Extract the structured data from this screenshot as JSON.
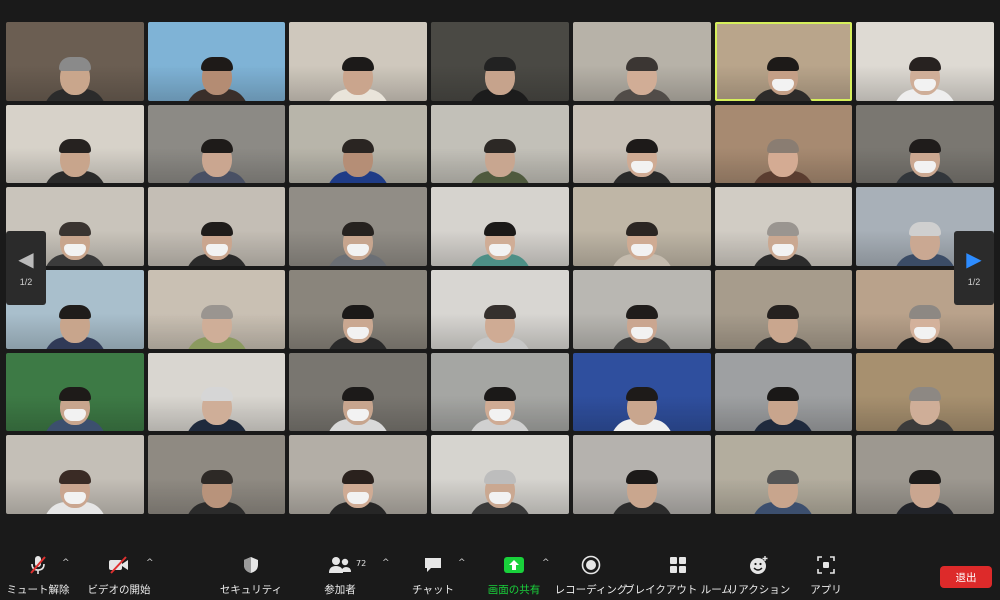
{
  "gallery": {
    "page_indicator_left": "1/2",
    "page_indicator_right": "1/2",
    "tiles": [
      {
        "bg": "#6b5e52",
        "skin": "#c9a68c",
        "hair": "#8a8a8a",
        "shirt": "#2b2b2b",
        "mask": false
      },
      {
        "bg": "#7fb3d6",
        "skin": "#b48c73",
        "hair": "#1e1a18",
        "shirt": "#3a2f2a",
        "mask": false
      },
      {
        "bg": "#cfc8bd",
        "skin": "#caa58d",
        "hair": "#1c1a19",
        "shirt": "#e9e4da",
        "mask": false
      },
      {
        "bg": "#4a4944",
        "skin": "#c6a38c",
        "hair": "#222",
        "shirt": "#1c1c1c",
        "mask": false
      },
      {
        "bg": "#b7b2a8",
        "skin": "#d1ad96",
        "hair": "#3b3633",
        "shirt": "#514c48",
        "mask": false
      },
      {
        "bg": "#b9a58b",
        "skin": "#c49f86",
        "hair": "#1d1a18",
        "shirt": "#2d2b2a",
        "mask": true
      },
      {
        "bg": "#dedad3",
        "skin": "#cfae98",
        "hair": "#272220",
        "shirt": "#eeeeee",
        "mask": true
      },
      {
        "bg": "#d7d2c9",
        "skin": "#c8a58c",
        "hair": "#262220",
        "shirt": "#2a2a2a",
        "mask": false
      },
      {
        "bg": "#8c8a85",
        "skin": "#caa690",
        "hair": "#1e1b19",
        "shirt": "#495064",
        "mask": false
      },
      {
        "bg": "#b8b5aa",
        "skin": "#b58e76",
        "hair": "#2a2522",
        "shirt": "#1f3c87",
        "mask": false
      },
      {
        "bg": "#c2c0b8",
        "skin": "#c8a690",
        "hair": "#2c2825",
        "shirt": "#4f5a3e",
        "mask": false
      },
      {
        "bg": "#c8c1b7",
        "skin": "#cfab94",
        "hair": "#1d1a19",
        "shirt": "#2a2a2a",
        "mask": true
      },
      {
        "bg": "#a78a71",
        "skin": "#d4ab93",
        "hair": "#8a7d72",
        "shirt": "#5a3d30",
        "mask": false
      },
      {
        "bg": "#7a7771",
        "skin": "#cba891",
        "hair": "#1f1c1b",
        "shirt": "#32363b",
        "mask": true
      },
      {
        "bg": "#c9c4bb",
        "skin": "#c8a58d",
        "hair": "#3a3430",
        "shirt": "#3b3b3b",
        "mask": true
      },
      {
        "bg": "#c4beb5",
        "skin": "#caa68f",
        "hair": "#1f1c1a",
        "shirt": "#2a2a2a",
        "mask": true
      },
      {
        "bg": "#918d86",
        "skin": "#c7a58e",
        "hair": "#26221f",
        "shirt": "#6b6f75",
        "mask": true
      },
      {
        "bg": "#d6d3ce",
        "skin": "#d0ad96",
        "hair": "#1b1918",
        "shirt": "#4d8f86",
        "mask": true
      },
      {
        "bg": "#bfb6a6",
        "skin": "#cfab93",
        "hair": "#2b2623",
        "shirt": "#c4bbae",
        "mask": true
      },
      {
        "bg": "#d1ccc4",
        "skin": "#caa891",
        "hair": "#9a9590",
        "shirt": "#2c2c2c",
        "mask": true
      },
      {
        "bg": "#a8b0b8",
        "skin": "#caa892",
        "hair": "#cfcfcf",
        "shirt": "#3b4c66",
        "mask": false
      },
      {
        "bg": "#a9bfcc",
        "skin": "#c8a58c",
        "hair": "#1f1c1a",
        "shirt": "#303a57",
        "mask": false
      },
      {
        "bg": "#c9c0b3",
        "skin": "#cfae98",
        "hair": "#9a9590",
        "shirt": "#8b9a5f",
        "mask": false
      },
      {
        "bg": "#8a857c",
        "skin": "#caa891",
        "hair": "#1b1918",
        "shirt": "#2a2a2a",
        "mask": true
      },
      {
        "bg": "#d8d6d2",
        "skin": "#cfab94",
        "hair": "#35302d",
        "shirt": "#c7c7c7",
        "mask": false
      },
      {
        "bg": "#b9b7b2",
        "skin": "#caa690",
        "hair": "#201d1b",
        "shirt": "#3c3c3c",
        "mask": true
      },
      {
        "bg": "#a79c8c",
        "skin": "#c9a68e",
        "hair": "#25211f",
        "shirt": "#2c2c2c",
        "mask": false
      },
      {
        "bg": "#b9a28b",
        "skin": "#d3b19b",
        "hair": "#8d8883",
        "shirt": "#1f1f1f",
        "mask": true
      },
      {
        "bg": "#3d7a45",
        "skin": "#c8a58d",
        "hair": "#1e1b19",
        "shirt": "#3c4f6e",
        "mask": true
      },
      {
        "bg": "#d9d6d0",
        "skin": "#cfae98",
        "hair": "#d6d6d6",
        "shirt": "#1f2a3d",
        "mask": false
      },
      {
        "bg": "#797670",
        "skin": "#c7a58e",
        "hair": "#1c1a19",
        "shirt": "#d9d9d9",
        "mask": true
      },
      {
        "bg": "#a5a6a3",
        "skin": "#cfab94",
        "hair": "#1b1918",
        "shirt": "#d0d0d0",
        "mask": true
      },
      {
        "bg": "#2f4f9e",
        "skin": "#c9a68e",
        "hair": "#1e1b19",
        "shirt": "#f0f0f0",
        "mask": false
      },
      {
        "bg": "#9ea0a2",
        "skin": "#c8a58d",
        "hair": "#1a1817",
        "shirt": "#1f2a3d",
        "mask": false
      },
      {
        "bg": "#a7906f",
        "skin": "#cfae98",
        "hair": "#8d8883",
        "shirt": "#3b3b3b",
        "mask": false
      },
      {
        "bg": "#c4bfb7",
        "skin": "#caa690",
        "hair": "#3a2b25",
        "shirt": "#e6e6e6",
        "mask": true
      },
      {
        "bg": "#8f8a82",
        "skin": "#b8937b",
        "hair": "#2d2926",
        "shirt": "#2b2b2b",
        "mask": false
      },
      {
        "bg": "#b3aea6",
        "skin": "#cfab94",
        "hair": "#2a211d",
        "shirt": "#262626",
        "mask": true
      },
      {
        "bg": "#d6d4cf",
        "skin": "#caa891",
        "hair": "#bdbdbd",
        "shirt": "#3a3a3a",
        "mask": true
      },
      {
        "bg": "#b5b2ae",
        "skin": "#c9a68e",
        "hair": "#1c1a19",
        "shirt": "#2c2c2c",
        "mask": false
      },
      {
        "bg": "#b3ad9e",
        "skin": "#c8a58d",
        "hair": "#555",
        "shirt": "#3c4f6e",
        "mask": false
      },
      {
        "bg": "#9d9890",
        "skin": "#caa690",
        "hair": "#1d1b1a",
        "shirt": "#22242a",
        "mask": false
      }
    ]
  },
  "toolbar": {
    "mute_label": "ミュート解除",
    "video_label": "ビデオの開始",
    "security_label": "セキュリティ",
    "participants_label": "参加者",
    "participants_count": "72",
    "chat_label": "チャット",
    "share_label": "画面の共有",
    "recording_label": "レコーディング",
    "breakout_label": "ブレイクアウト ルーム",
    "reactions_label": "リアクション",
    "apps_label": "アプリ",
    "leave_label": "退出",
    "caret": "^"
  },
  "colors": {
    "background": "#1a1a1a",
    "active_speaker_border": "#d6ef5c",
    "share_green": "#19d13b",
    "leave_red": "#dd2a2a",
    "pager_blue": "#2d8cff"
  }
}
